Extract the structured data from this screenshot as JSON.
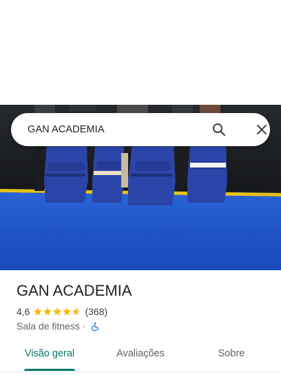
{
  "search": {
    "query": "GAN ACADEMIA"
  },
  "place": {
    "name": "GAN ACADEMIA",
    "rating": "4,6",
    "rating_value": 4.6,
    "max_stars": 5,
    "review_count": "(368)",
    "category": "Sala de fitness",
    "separator": "·"
  },
  "tabs": [
    {
      "label": "Visão geral",
      "active": true
    },
    {
      "label": "Avaliações",
      "active": false
    },
    {
      "label": "Sobre",
      "active": false
    }
  ],
  "colors": {
    "accent": "#00796b",
    "star": "#fbbc04",
    "mat_blue": "#1a54c9",
    "accessibility_icon": "#1a73e8"
  },
  "icons": {
    "search": "search-icon",
    "close": "close-icon",
    "accessibility": "wheelchair-icon"
  }
}
